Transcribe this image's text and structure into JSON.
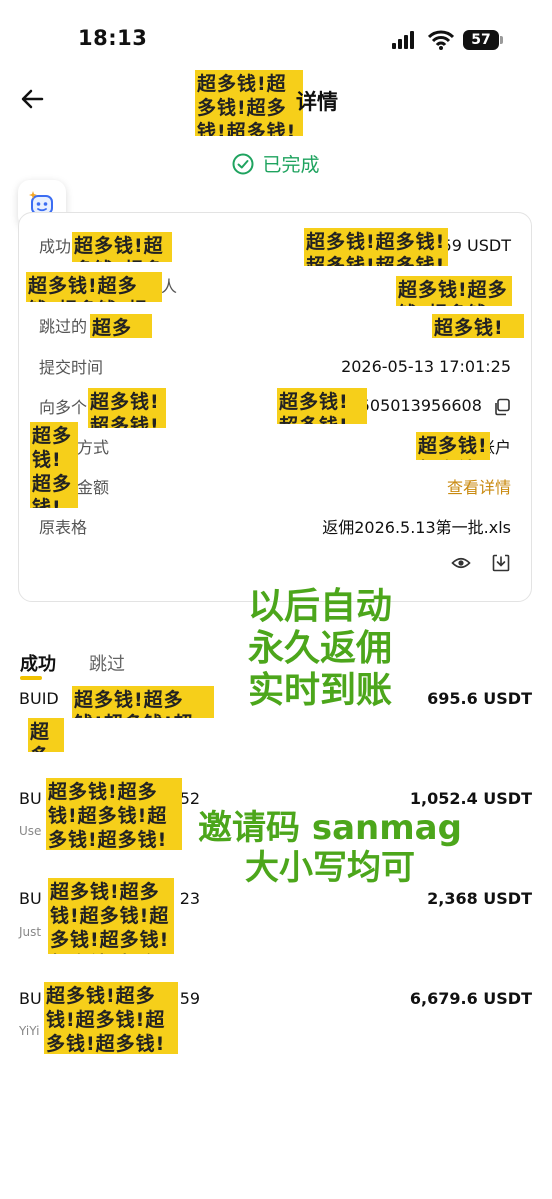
{
  "status_bar": {
    "time": "18:13",
    "battery": "57"
  },
  "header": {
    "title_suffix": "详情"
  },
  "status": {
    "label": "已完成"
  },
  "details": {
    "success_label": "成功",
    "success_value": "59 USDT",
    "payee_suffix": "人",
    "skipped_label": "跳过的",
    "submit_time_label": "提交时间",
    "submit_time_value": "2026-05-13 17:01:25",
    "multi_label": "向多个",
    "multi_value": "505013956608",
    "method_label": "方式",
    "method_value": "账户",
    "amount_label": "金额",
    "amount_link": "查看详情",
    "sheet_label": "原表格",
    "sheet_value": "返佣2026.5.13第一批.xls"
  },
  "promo": {
    "lines1": [
      "以后自动",
      "永久返佣",
      "实时到账"
    ],
    "lines2": [
      "邀请码 sanmag",
      "大小写均可"
    ]
  },
  "tabs": {
    "success": "成功",
    "skipped": "跳过"
  },
  "list": [
    {
      "id": "BUID",
      "amount": "695.6 USDT",
      "sub": ""
    },
    {
      "id": "BU",
      "id_suffix": "52",
      "amount": "1,052.4 USDT",
      "sub": "Use"
    },
    {
      "id": "BU",
      "id_suffix": "23",
      "amount": "2,368 USDT",
      "sub": "Just"
    },
    {
      "id": "BU",
      "id_suffix": "59",
      "amount": "6,679.6 USDT",
      "sub": "YiYi"
    }
  ],
  "colors": {
    "success_green": "#1fa35f",
    "accent_gold": "#c98a10",
    "promo_green": "#4ca61b",
    "censor_yellow": "#f6cf1a"
  }
}
